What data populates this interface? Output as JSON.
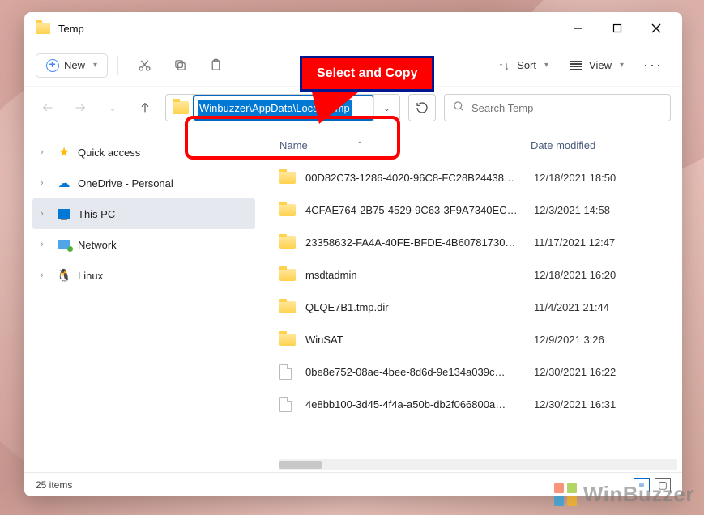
{
  "window_title": "Temp",
  "toolbar": {
    "new": "New",
    "sort": "Sort",
    "view": "View"
  },
  "address_bar": {
    "path": "Winbuzzer\\AppData\\Local\\Temp",
    "selected": true
  },
  "search": {
    "placeholder": "Search Temp"
  },
  "sidebar": [
    {
      "label": "Quick access",
      "icon": "star"
    },
    {
      "label": "OneDrive - Personal",
      "icon": "cloud"
    },
    {
      "label": "This PC",
      "icon": "pc",
      "selected": true
    },
    {
      "label": "Network",
      "icon": "net"
    },
    {
      "label": "Linux",
      "icon": "tux"
    }
  ],
  "columns": {
    "name": "Name",
    "date": "Date modified"
  },
  "files": [
    {
      "type": "folder",
      "name": "00D82C73-1286-4020-96C8-FC28B24438…",
      "date": "12/18/2021 18:50"
    },
    {
      "type": "folder",
      "name": "4CFAE764-2B75-4529-9C63-3F9A7340EC…",
      "date": "12/3/2021 14:58"
    },
    {
      "type": "folder",
      "name": "23358632-FA4A-40FE-BFDE-4B60781730…",
      "date": "11/17/2021 12:47"
    },
    {
      "type": "folder",
      "name": "msdtadmin",
      "date": "12/18/2021 16:20"
    },
    {
      "type": "folder",
      "name": "QLQE7B1.tmp.dir",
      "date": "11/4/2021 21:44"
    },
    {
      "type": "folder",
      "name": "WinSAT",
      "date": "12/9/2021 3:26"
    },
    {
      "type": "file",
      "name": "0be8e752-08ae-4bee-8d6d-9e134a039c…",
      "date": "12/30/2021 16:22"
    },
    {
      "type": "file",
      "name": "4e8bb100-3d45-4f4a-a50b-db2f066800a…",
      "date": "12/30/2021 16:31"
    }
  ],
  "status": {
    "item_count": "25 items"
  },
  "callout": {
    "text": "Select and Copy"
  },
  "watermark": "WinBuzzer"
}
